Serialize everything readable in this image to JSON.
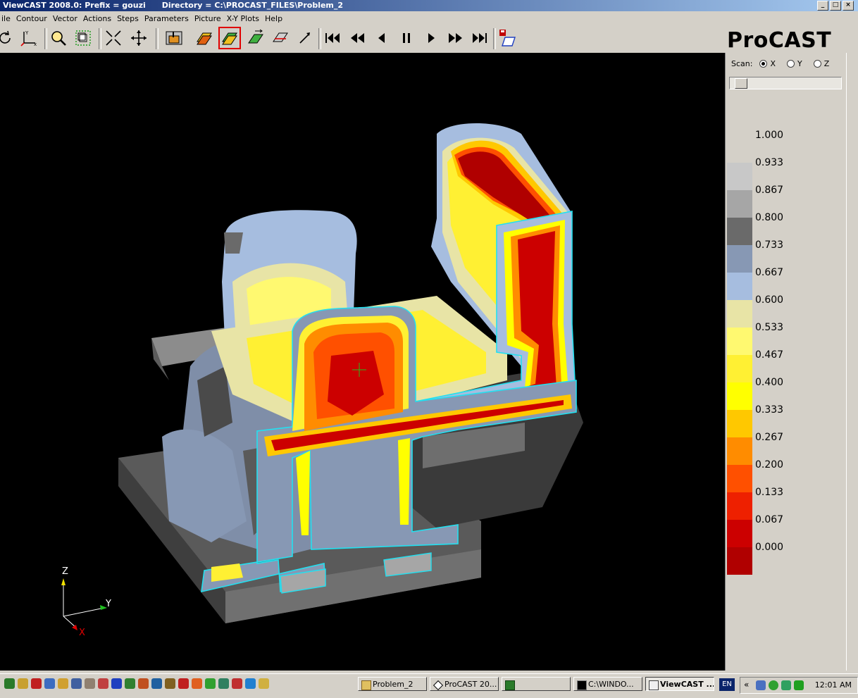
{
  "window": {
    "title": "ViewCAST 2008.0: Prefix = gouzi",
    "directory": "Directory = C:\\PROCAST_FILES\\Problem_2",
    "controls": [
      "_",
      "□",
      "×"
    ]
  },
  "menu": {
    "items": [
      "ile",
      "Contour",
      "Vector",
      "Actions",
      "Steps",
      "Parameters",
      "Picture",
      "X-Y Plots",
      "Help"
    ]
  },
  "toolbar": {
    "icons": [
      "rotate-icon",
      "axes-icon",
      "zoom-icon",
      "box-icon",
      "shrink-icon",
      "move-icon",
      "cast-icon",
      "layers-icon",
      "layers-selected-icon",
      "vector-layers-icon",
      "cut-icon",
      "probe-icon",
      "first-step-icon",
      "rewind-icon",
      "step-back-icon",
      "pause-icon",
      "play-icon",
      "fast-forward-icon",
      "last-step-icon",
      "save-movie-icon"
    ]
  },
  "brand": {
    "logo": "ProCAST"
  },
  "scan": {
    "label": "Scan:",
    "options": [
      "X",
      "Y",
      "Z"
    ],
    "selected": "X",
    "slider_value": 0.05
  },
  "legend": {
    "entries": [
      {
        "value": "1.000",
        "color": ""
      },
      {
        "value": "0.933",
        "color": "#c8c8c8"
      },
      {
        "value": "0.867",
        "color": "#a6a6a6"
      },
      {
        "value": "0.800",
        "color": "#6a6a6a"
      },
      {
        "value": "0.733",
        "color": "#8798b4"
      },
      {
        "value": "0.667",
        "color": "#a6bddf"
      },
      {
        "value": "0.600",
        "color": "#e8e4a6"
      },
      {
        "value": "0.533",
        "color": "#fff970"
      },
      {
        "value": "0.467",
        "color": "#fff033"
      },
      {
        "value": "0.400",
        "color": "#ffff00"
      },
      {
        "value": "0.333",
        "color": "#ffc800"
      },
      {
        "value": "0.267",
        "color": "#ff8c00"
      },
      {
        "value": "0.200",
        "color": "#ff5000"
      },
      {
        "value": "0.133",
        "color": "#ee2000"
      },
      {
        "value": "0.067",
        "color": "#cc0000"
      },
      {
        "value": "0.000",
        "color": "#b00000"
      }
    ]
  },
  "axes": {
    "z": "Z",
    "y": "Y",
    "x": "X"
  },
  "taskbar": {
    "quick_icons": [
      "#2a7a2a",
      "#c8a030",
      "#c02020",
      "#3c6cc0",
      "#d0a030",
      "#4060a0",
      "#908070",
      "#c04040",
      "#2040c0",
      "#308030",
      "#c05020",
      "#2060a0",
      "#806020",
      "#c02020",
      "#e06020",
      "#30a030",
      "#308060",
      "#c03030",
      "#2080d0",
      "#d0b040"
    ],
    "buttons": [
      {
        "label": "Problem_2",
        "active": false
      },
      {
        "label": "ProCAST 20...",
        "active": false
      },
      {
        "label": "",
        "active": false
      },
      {
        "label": "C:\\WINDO...",
        "active": false
      },
      {
        "label": "ViewCAST ...",
        "active": true
      }
    ],
    "language": "EN",
    "clock": "12:01 AM"
  }
}
